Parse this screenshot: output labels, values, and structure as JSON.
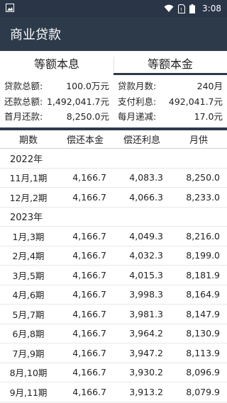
{
  "status": {
    "time": "3:08"
  },
  "appbar": {
    "title": "商业贷款"
  },
  "tabs": [
    {
      "label": "等额本息"
    },
    {
      "label": "等额本金"
    }
  ],
  "summary": {
    "rows": [
      [
        {
          "label": "贷款总额:",
          "value": "100.0万元"
        },
        {
          "label": "贷款月数:",
          "value": "240月"
        }
      ],
      [
        {
          "label": "还款总额:",
          "value": "1,492,041.7元"
        },
        {
          "label": "支付利息:",
          "value": "492,041.7元"
        }
      ],
      [
        {
          "label": "首月还款:",
          "value": "8,250.0元"
        },
        {
          "label": "每月递减:",
          "value": "17.0元"
        }
      ]
    ]
  },
  "table": {
    "headers": [
      "期数",
      "偿还本金",
      "偿还利息",
      "月供"
    ],
    "sections": [
      {
        "year": "2022年",
        "rows": [
          [
            "11月,1期",
            "4,166.7",
            "4,083.3",
            "8,250.0"
          ],
          [
            "12月,2期",
            "4,166.7",
            "4,066.3",
            "8,233.0"
          ]
        ]
      },
      {
        "year": "2023年",
        "rows": [
          [
            "1月,3期",
            "4,166.7",
            "4,049.3",
            "8,216.0"
          ],
          [
            "2月,4期",
            "4,166.7",
            "4,032.3",
            "8,199.0"
          ],
          [
            "3月,5期",
            "4,166.7",
            "4,015.3",
            "8,181.9"
          ],
          [
            "4月,6期",
            "4,166.7",
            "3,998.3",
            "8,164.9"
          ],
          [
            "5月,7期",
            "4,166.7",
            "3,981.3",
            "8,147.9"
          ],
          [
            "6月,8期",
            "4,166.7",
            "3,964.2",
            "8,130.9"
          ],
          [
            "7月,9期",
            "4,166.7",
            "3,947.2",
            "8,113.9"
          ],
          [
            "8月,10期",
            "4,166.7",
            "3,930.2",
            "8,096.9"
          ],
          [
            "9月,11期",
            "4,166.7",
            "3,913.2",
            "8,079.9"
          ]
        ]
      }
    ]
  }
}
